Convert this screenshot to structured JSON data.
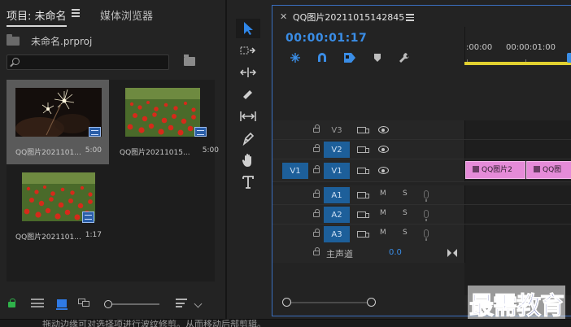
{
  "project_panel": {
    "tab_label": "项目: 未命名",
    "other_tab_label": "媒体浏览器",
    "project_file": "未命名.prproj",
    "search": {
      "value": "",
      "placeholder": ""
    },
    "items": [
      {
        "name": "QQ图片2021101...",
        "duration": "5:00",
        "kind": "video",
        "thumb": "sparklers"
      },
      {
        "name": "QQ图片20211015...",
        "duration": "5:00",
        "kind": "video",
        "thumb": "flowers"
      },
      {
        "name": "QQ图片2021101...",
        "duration": "1:17",
        "kind": "sequence",
        "thumb": "flowers"
      }
    ],
    "toolbar": [
      "lock-icon",
      "list-view-icon",
      "icon-view-icon",
      "freeform-view-icon",
      "zoom-slider",
      "sort-icon"
    ]
  },
  "tools": [
    "selection",
    "track-select-forward",
    "ripple-edit",
    "razor",
    "slip",
    "pen",
    "hand",
    "type"
  ],
  "timeline": {
    "tab_label": "QQ图片20211015142845",
    "timecode": "00:00:01:17",
    "ruler_labels": [
      ":00:00",
      "00:00:01:00"
    ],
    "video_tracks": [
      {
        "name": "V3",
        "source": "",
        "targeted": false
      },
      {
        "name": "V2",
        "source": "",
        "targeted": true
      },
      {
        "name": "V1",
        "source": "V1",
        "targeted": true
      }
    ],
    "audio_tracks": [
      {
        "name": "A1",
        "m": "M",
        "s": "S"
      },
      {
        "name": "A2",
        "m": "M",
        "s": "S"
      },
      {
        "name": "A3",
        "m": "M",
        "s": "S"
      }
    ],
    "master_label": "主声道",
    "master_value": "0.0",
    "clips": [
      {
        "label": "QQ图片2"
      },
      {
        "label": "QQ图"
      }
    ]
  },
  "watermark": "最需教育",
  "status_text": "拖动边缘可对选择项进行波纹修剪。从而移动后部剪辑。",
  "colors": {
    "accent": "#3a8de6",
    "clip": "#e58bd8",
    "work_bar": "#e2d130",
    "target": "#1d5f9a"
  }
}
